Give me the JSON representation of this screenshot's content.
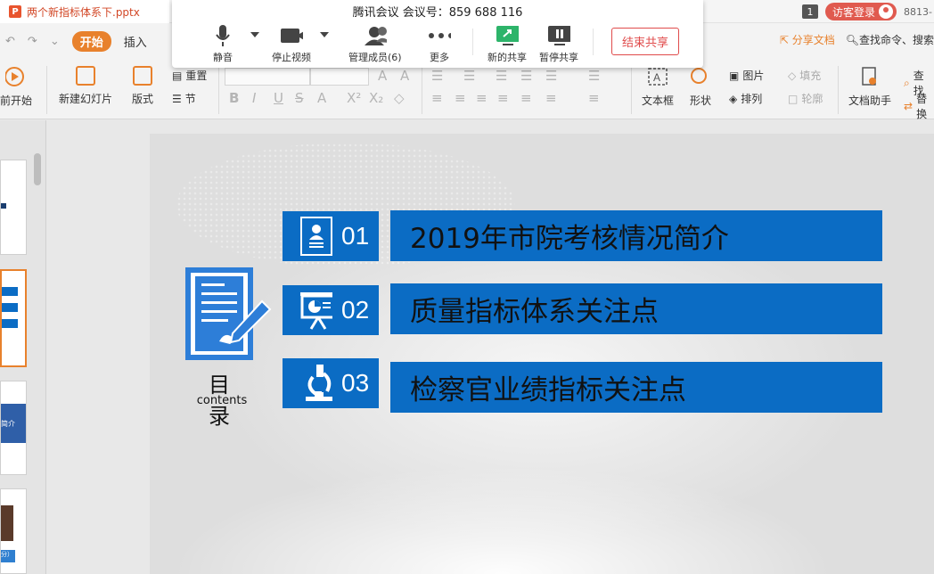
{
  "titlebar": {
    "doc_title": "两个新指标体系下.pptx",
    "page_number": "1",
    "guest_login": "访客登录",
    "account": "8813-"
  },
  "menubar": {
    "start": "开始",
    "insert": "插入",
    "share_doc": "分享文档",
    "search": "查找命令、搜索"
  },
  "ribbon": {
    "from_start": "前开始",
    "new_slide": "新建幻灯片",
    "layout": "版式",
    "reset": "重置",
    "section": "节",
    "text_box": "文本框",
    "shape": "形状",
    "picture": "图片",
    "fill": "填充",
    "arrange": "排列",
    "outline": "轮廓",
    "doc_helper": "文档助手",
    "find": "查找",
    "replace": "替换"
  },
  "meeting": {
    "title": "腾讯会议 会议号：859 688 116",
    "mute": "静音",
    "stop_video": "停止视频",
    "manage_members": "管理成员(6)",
    "more": "更多",
    "new_share": "新的共享",
    "pause_share": "暂停共享",
    "end_share": "结束共享"
  },
  "thumbnails": {
    "thumb3_text": "简介",
    "thumb4_text": "分）"
  },
  "slide": {
    "toc_title": "目 录",
    "toc_subtitle": "contents",
    "items": [
      {
        "num": "01",
        "text": "2019年市院考核情况简介"
      },
      {
        "num": "02",
        "text": "质量指标体系关注点"
      },
      {
        "num": "03",
        "text": "检察官业绩指标关注点"
      }
    ],
    "accent_color": "#0b6cc4"
  }
}
